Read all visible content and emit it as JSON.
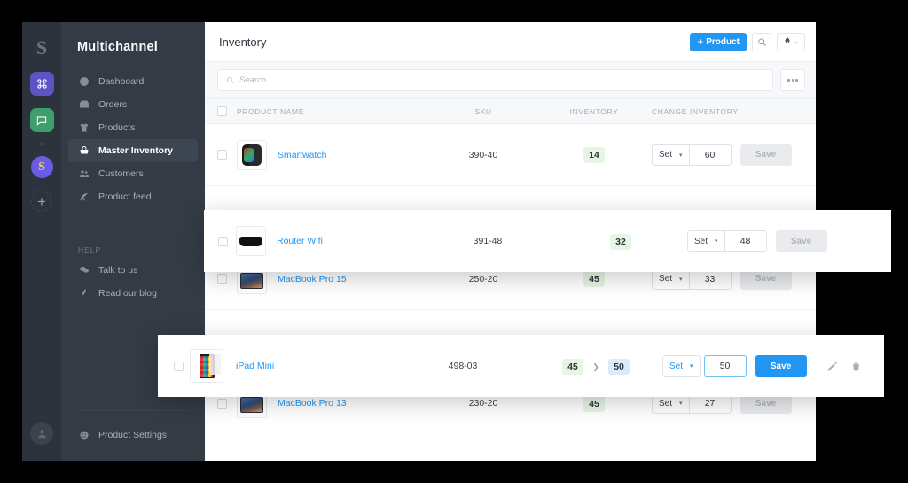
{
  "rail": {
    "logo": "S",
    "apps": [
      {
        "name": "hub-app",
        "glyph": "⌘"
      },
      {
        "name": "chat-app",
        "glyph": "▢"
      }
    ],
    "avatar_letter": "S",
    "add_label": "+"
  },
  "sidebar": {
    "brand": "Multichannel",
    "items": [
      {
        "label": "Dashboard",
        "icon": "dashboard-icon",
        "active": false
      },
      {
        "label": "Orders",
        "icon": "orders-icon",
        "active": false
      },
      {
        "label": "Products",
        "icon": "products-icon",
        "active": false
      },
      {
        "label": "Master Inventory",
        "icon": "inventory-icon",
        "active": true
      },
      {
        "label": "Customers",
        "icon": "customers-icon",
        "active": false
      },
      {
        "label": "Product feed",
        "icon": "feed-icon",
        "active": false
      }
    ],
    "help_title": "HELP",
    "help_items": [
      {
        "label": "Talk to us",
        "icon": "chat-bubble-icon"
      },
      {
        "label": "Read our blog",
        "icon": "pen-icon"
      }
    ],
    "settings": {
      "label": "Product Settings",
      "icon": "settings-icon"
    }
  },
  "header": {
    "title": "Inventory",
    "add_product_label": "Product",
    "add_product_plus": "+",
    "search_icon": "search-icon",
    "apps_icon": "puzzle-icon",
    "chevron": "⌄"
  },
  "search": {
    "placeholder": "Search...",
    "value": "",
    "more_label": "more-options"
  },
  "table": {
    "columns": [
      "PRODUCT NAME",
      "SKU",
      "INVENTORY",
      "CHANGE INVENTORY"
    ],
    "set_label": "Set",
    "save_label": "Save",
    "rows": [
      {
        "name": "Smartwatch",
        "sku": "390-40",
        "inventory": "14",
        "new_inventory": null,
        "input_value": "60",
        "active": false,
        "floating": false,
        "thumb": "smartwatch-thumb"
      },
      {
        "name": "Router Wifi",
        "sku": "391-48",
        "inventory": "32",
        "new_inventory": null,
        "input_value": "48",
        "active": false,
        "floating": true,
        "thumb": "router-thumb"
      },
      {
        "name": "MacBook Pro 15",
        "sku": "250-20",
        "inventory": "45",
        "new_inventory": null,
        "input_value": "33",
        "active": false,
        "floating": false,
        "thumb": "macbook-thumb"
      },
      {
        "name": "iPad Mini",
        "sku": "498-03",
        "inventory": "45",
        "new_inventory": "50",
        "input_value": "50",
        "active": true,
        "floating": true,
        "thumb": "ipad-thumb",
        "edit_icon": "pencil-icon",
        "delete_icon": "trash-icon"
      },
      {
        "name": "MacBook Pro 13",
        "sku": "230-20",
        "inventory": "45",
        "new_inventory": null,
        "input_value": "27",
        "active": false,
        "floating": false,
        "thumb": "macbook-thumb"
      }
    ]
  },
  "colors": {
    "accent": "#2196f3",
    "sidebar": "#343b45",
    "rail": "#2d333c",
    "badge_green": "#e7f5e4",
    "badge_blue": "#d9ecfb"
  }
}
